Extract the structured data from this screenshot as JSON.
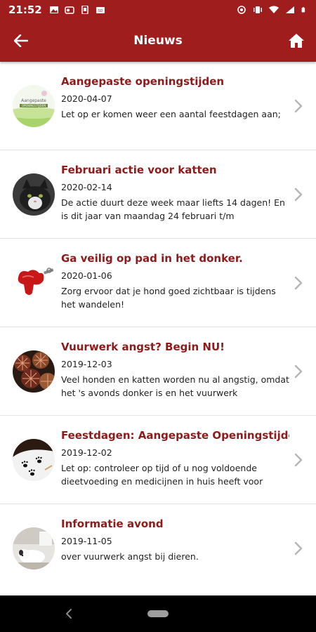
{
  "status_bar": {
    "time": "21:52",
    "icons_left": [
      "image-icon",
      "card-icon",
      "phone-icon",
      "sd-card-icon"
    ],
    "icons_right": [
      "circle-icon",
      "vibrate-icon",
      "wifi-icon",
      "signal-icon",
      "battery-icon"
    ]
  },
  "app_bar": {
    "title": "Nieuws",
    "back_icon": "arrow-left-icon",
    "home_icon": "home-icon",
    "color": "#a01d1d"
  },
  "news": [
    {
      "title": "Aangepaste openingstijden",
      "date": "2020-04-07",
      "excerpt": "Let op er komen weer een aantal feestdagen aan;",
      "thumb": "spring-banner-thumb"
    },
    {
      "title": "Februari actie voor katten",
      "date": "2020-02-14",
      "excerpt": "De actie duurt deze week maar liefts 14 dagen! En is dit jaar van maandag 24 februari t/m",
      "thumb": "cat-thumb"
    },
    {
      "title": "Ga veilig op pad in het donker.",
      "date": "2020-01-06",
      "excerpt": "Zorg ervoor dat je hond goed zichtbaar is tijdens het wandelen!",
      "thumb": "red-light-thumb"
    },
    {
      "title": "Vuurwerk angst? Begin NU!",
      "date": "2019-12-03",
      "excerpt": "Veel honden en katten worden nu al angstig, omdat het 's avonds donker is en het vuurwerk",
      "thumb": "fireworks-thumb"
    },
    {
      "title": "Feestdagen: Aangepaste Openingstijden",
      "date": "2019-12-02",
      "excerpt": "Let op: controleer op tijd of u nog voldoende dieetvoeding en medicijnen in huis heeft voor",
      "thumb": "paw-prints-thumb"
    },
    {
      "title": "Informatie avond",
      "date": "2019-11-05",
      "excerpt": "over vuurwerk angst bij dieren.",
      "thumb": "dog-thumb"
    }
  ],
  "nav_bar": {
    "back_icon": "nav-back-icon",
    "home_icon": "nav-home-pill"
  }
}
